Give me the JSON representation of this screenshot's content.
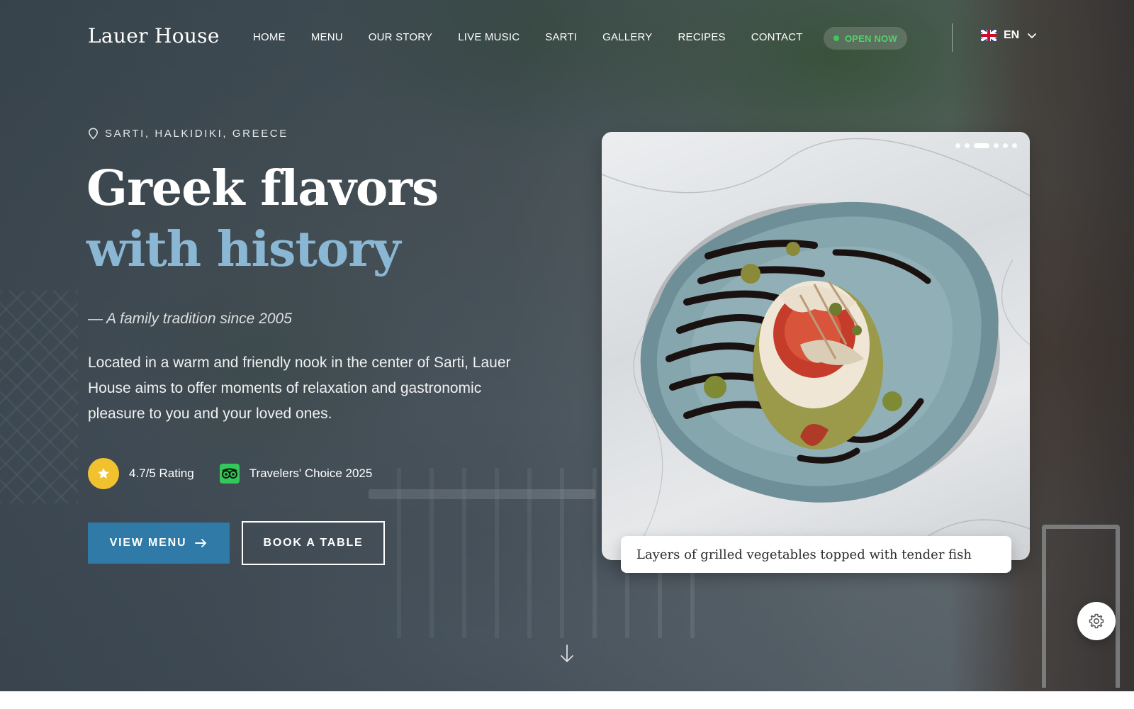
{
  "brand": {
    "name": "Lauer House"
  },
  "nav": {
    "items": [
      {
        "label": "HOME"
      },
      {
        "label": "MENU"
      },
      {
        "label": "OUR STORY"
      },
      {
        "label": "LIVE MUSIC"
      },
      {
        "label": "SARTI"
      },
      {
        "label": "GALLERY"
      },
      {
        "label": "RECIPES"
      },
      {
        "label": "CONTACT"
      }
    ],
    "status_badge": "OPEN NOW",
    "language": "EN"
  },
  "hero": {
    "location": "SARTI, HALKIDIKI, GREECE",
    "headline_line1": "Greek flavors",
    "headline_line2": "with history",
    "tagline": "— A family tradition since 2005",
    "description": "Located in a warm and friendly nook in the center of Sarti, Lauer House aims to offer moments of relaxation and gastronomic pleasure to you and your loved ones.",
    "rating": "4.7/5 Rating",
    "award": "Travelers' Choice 2025",
    "primary_button": "VIEW MENU",
    "secondary_button": "BOOK A TABLE"
  },
  "gallery": {
    "caption": "Layers of grilled vegetables topped with tender fish",
    "slide_count": 6,
    "active_slide": 3
  },
  "colors": {
    "accent_blue": "#2f7aa6",
    "headline_blue": "#8ab8d4",
    "open_green": "#3ec75a",
    "star_yellow": "#f2c12e"
  },
  "icons": {
    "location": "map-pin-icon",
    "rating": "star-icon",
    "award": "tripadvisor-icon",
    "button_arrow": "arrow-right-icon",
    "language_dropdown": "chevron-down-icon",
    "scroll": "arrow-down-icon",
    "settings": "gear-icon"
  }
}
